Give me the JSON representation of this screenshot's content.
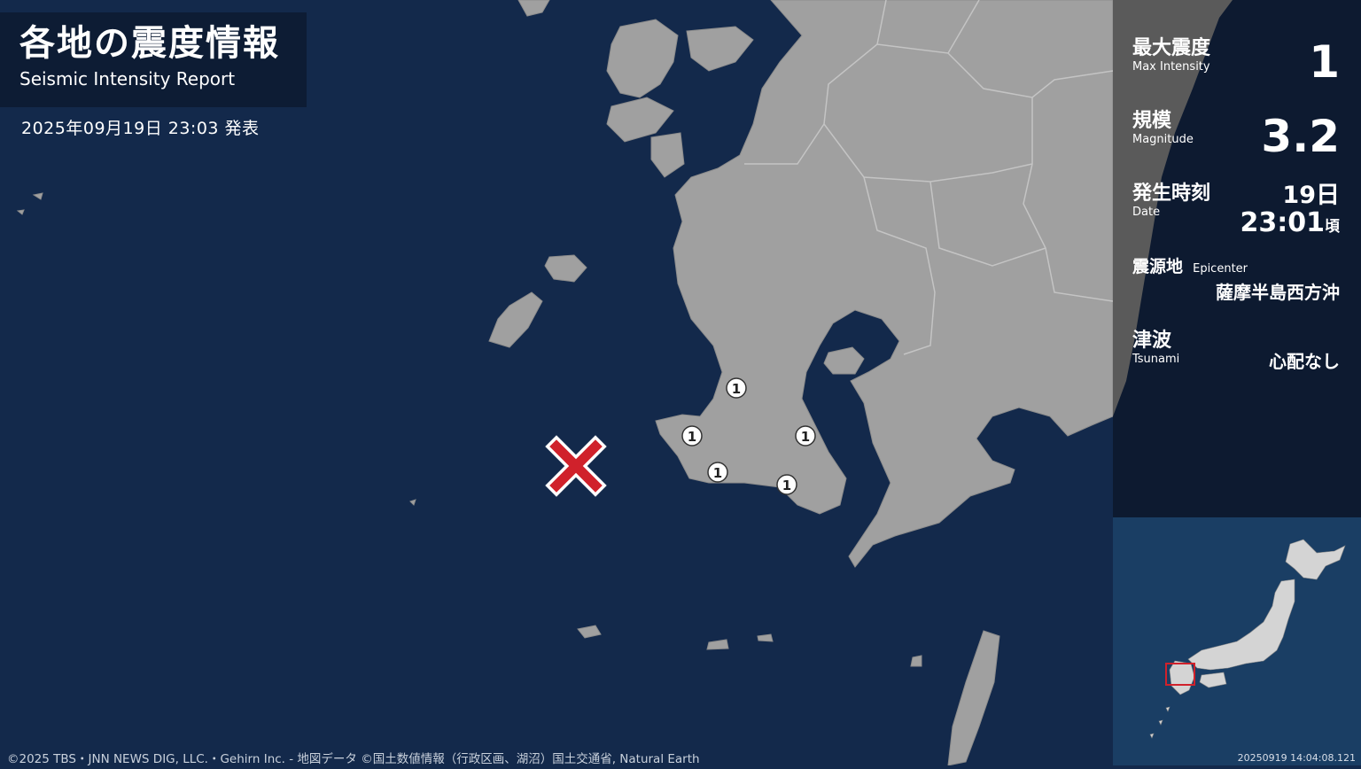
{
  "header": {
    "title_jp": "各地の震度情報",
    "title_en": "Seismic Intensity Report",
    "issued": "2025年09月19日 23:03 発表"
  },
  "info": {
    "max_intensity": {
      "label_jp": "最大震度",
      "label_en": "Max Intensity",
      "value": "1"
    },
    "magnitude": {
      "label_jp": "規模",
      "label_en": "Magnitude",
      "value": "3.2"
    },
    "time": {
      "label_jp": "発生時刻",
      "label_en": "Date",
      "day": "19日",
      "clock": "23:01",
      "suffix": "頃"
    },
    "epicenter": {
      "label_jp": "震源地",
      "label_en": "Epicenter",
      "value": "薩摩半島西方沖"
    },
    "tsunami": {
      "label_jp": "津波",
      "label_en": "Tsunami",
      "value": "心配なし"
    }
  },
  "map": {
    "intensity_markers": [
      {
        "intensity": "1"
      },
      {
        "intensity": "1"
      },
      {
        "intensity": "1"
      },
      {
        "intensity": "1"
      },
      {
        "intensity": "1"
      }
    ],
    "epicenter_icon": "cross-icon",
    "colors": {
      "sea": "#13294b",
      "land": "#a0a0a0",
      "epicenter": "#d0212b",
      "marker": "#ffffff"
    }
  },
  "footer": {
    "credits": "©2025 TBS・JNN NEWS DIG, LLC.・Gehirn Inc. - 地図データ ©国土数値情報（行政区画、湖沼）国土交通省, Natural Earth",
    "timestamp": "20250919 14:04:08.121"
  }
}
